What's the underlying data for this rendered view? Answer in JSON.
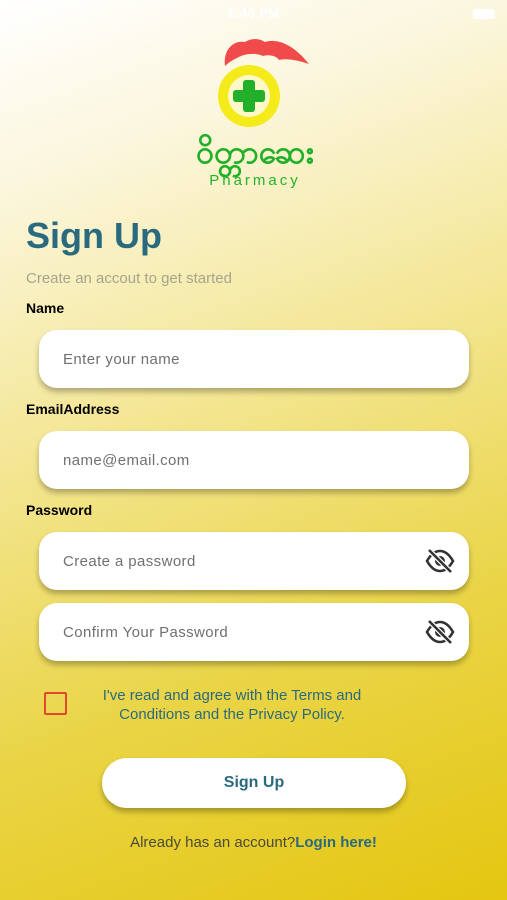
{
  "status_bar": {
    "time": "1:46 PM"
  },
  "logo": {
    "myanmar_text": "ဝိတ္တာဆေး",
    "pharmacy_text": "Pharmacy",
    "icon": "pharmacy-cross-icon"
  },
  "header": {
    "title": "Sign Up",
    "subtitle": "Create an accout to get started"
  },
  "form": {
    "name_label": "Name",
    "name_placeholder": "Enter your name",
    "email_label": "EmailAddress",
    "email_placeholder": "name@email.com",
    "password_label": "Password",
    "password_placeholder": "Create a password",
    "confirm_placeholder": "Confirm Your Password",
    "eye_icon": "eye-slash-icon"
  },
  "terms": {
    "text": "I've read and agree with the Terms and Conditions and the Privacy Policy."
  },
  "actions": {
    "signup_label": "Sign Up",
    "login_prefix": "Already has an account?",
    "login_link": "Login here!"
  },
  "colors": {
    "accent": "#2a6a7e",
    "logo_green": "#22b02a",
    "logo_yellow": "#f5ea1a",
    "logo_red": "#f04a4a",
    "checkbox_border": "#e2472f"
  }
}
